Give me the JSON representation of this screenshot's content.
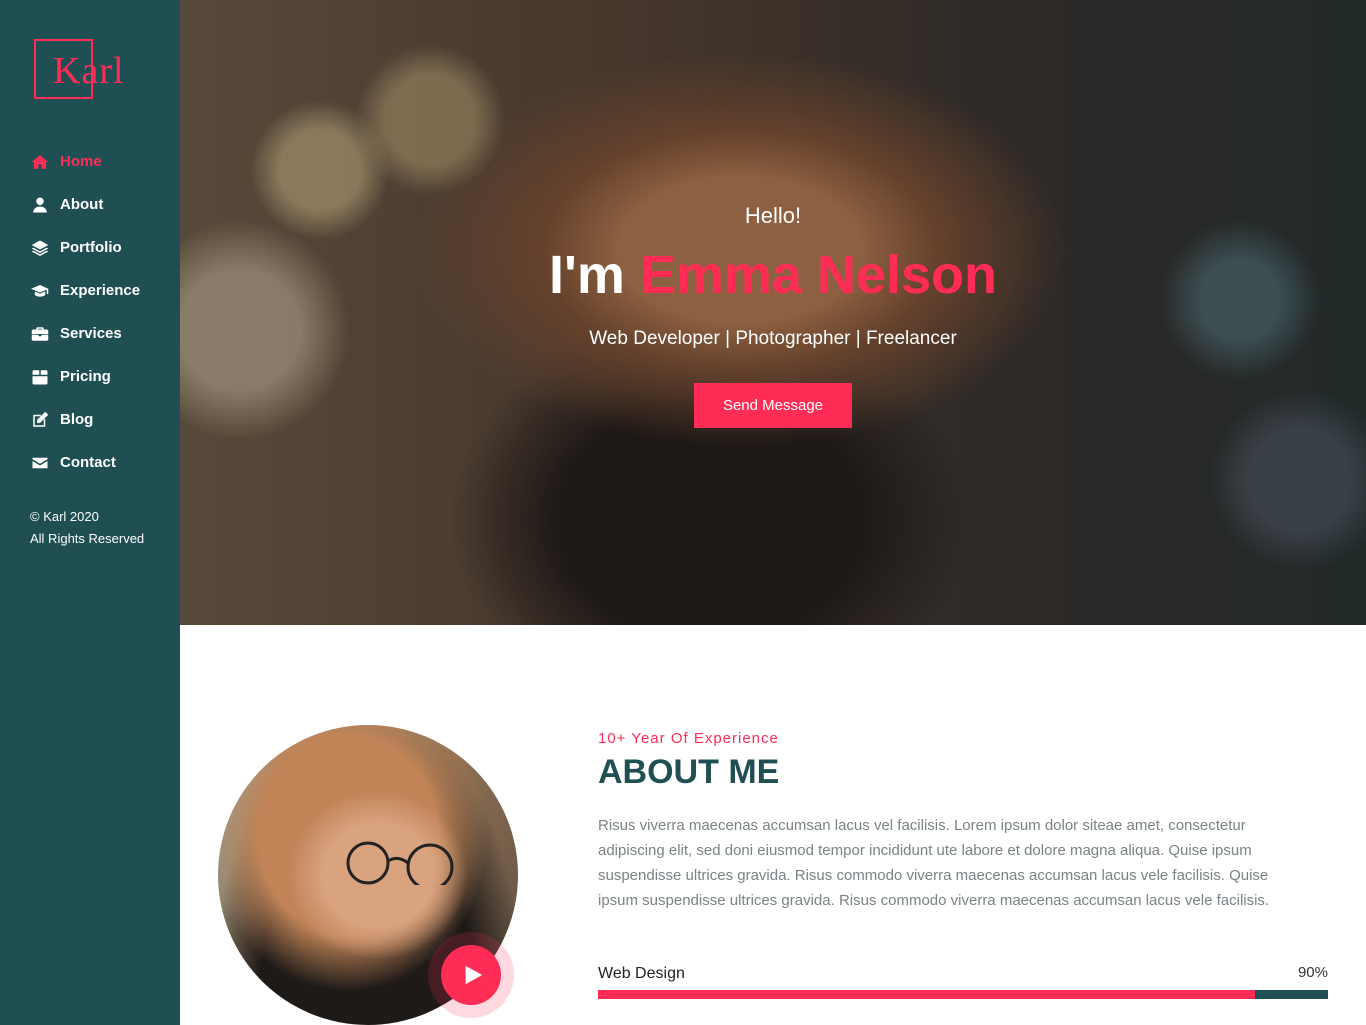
{
  "sidebar": {
    "logo_letter": "K",
    "logo_text": "arl",
    "nav": [
      {
        "label": "Home",
        "icon": "home-icon",
        "active": true
      },
      {
        "label": "About",
        "icon": "user-icon",
        "active": false
      },
      {
        "label": "Portfolio",
        "icon": "layers-icon",
        "active": false
      },
      {
        "label": "Experience",
        "icon": "graduation-cap-icon",
        "active": false
      },
      {
        "label": "Services",
        "icon": "briefcase-icon",
        "active": false
      },
      {
        "label": "Pricing",
        "icon": "box-icon",
        "active": false
      },
      {
        "label": "Blog",
        "icon": "edit-icon",
        "active": false
      },
      {
        "label": "Contact",
        "icon": "envelope-icon",
        "active": false
      }
    ],
    "copyright_line1": "© Karl 2020",
    "copyright_line2": "All Rights Reserved"
  },
  "hero": {
    "greeting": "Hello!",
    "name_prefix": "I'm",
    "name": "Emma Nelson",
    "roles": "Web Developer | Photographer | Freelancer",
    "button_label": "Send Message"
  },
  "about": {
    "subtitle": "10+ Year Of Experience",
    "title": "ABOUT ME",
    "text": "Risus viverra maecenas accumsan lacus vel facilisis. Lorem ipsum dolor siteae amet, consectetur adipiscing elit, sed doni eiusmod tempor incididunt ute labore et dolore magna aliqua. Quise ipsum suspendisse ultrices gravida. Risus commodo viverra maecenas accumsan lacus vele facilisis. Quise ipsum suspendisse ultrices gravida. Risus commodo viverra maecenas accumsan lacus vele facilisis.",
    "skill": {
      "label": "Web Design",
      "percent_label": "90%",
      "percent": 90
    }
  },
  "colors": {
    "accent": "#ff2d55",
    "sidebar": "#1f4f52"
  }
}
